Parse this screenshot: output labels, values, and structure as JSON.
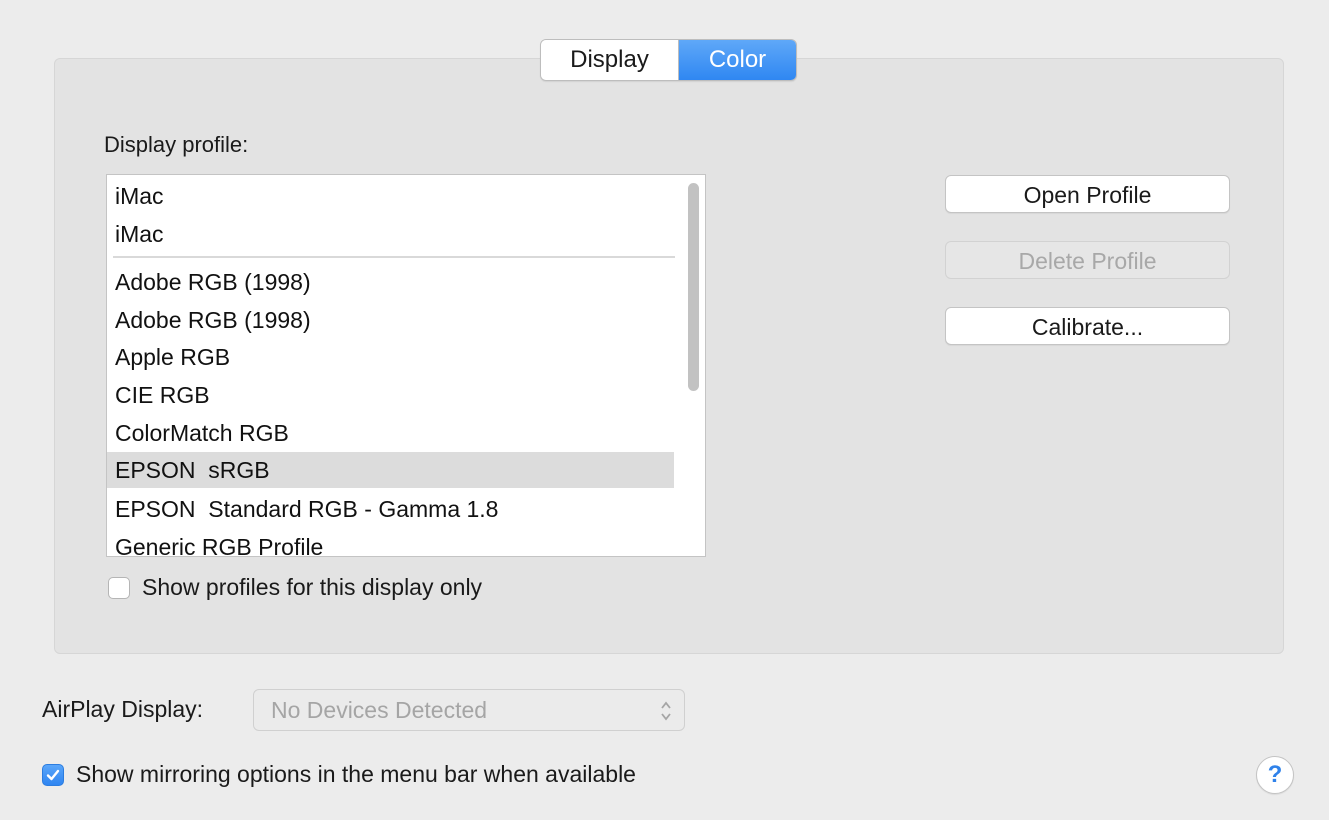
{
  "tabs": [
    {
      "label": "Display",
      "selected": false
    },
    {
      "label": "Color",
      "selected": true
    }
  ],
  "color_panel": {
    "profile_label": "Display profile:",
    "profiles": [
      "iMac",
      "iMac",
      "Adobe RGB (1998)",
      "Adobe RGB (1998)",
      "Apple RGB",
      "CIE RGB",
      "ColorMatch RGB",
      "EPSON  sRGB",
      "EPSON  Standard RGB - Gamma 1.8",
      "Generic RGB Profile"
    ],
    "selected_profile": "EPSON  sRGB",
    "show_display_only_label": "Show profiles for this display only",
    "show_display_only_checked": false,
    "buttons": {
      "open": "Open Profile",
      "delete": "Delete Profile",
      "calibrate": "Calibrate..."
    }
  },
  "airplay": {
    "label": "AirPlay Display:",
    "value": "No Devices Detected"
  },
  "mirroring": {
    "label": "Show mirroring options in the menu bar when available",
    "checked": true
  },
  "colors": {
    "accent": "#2f87f2",
    "selected_row": "#dcdcdc"
  }
}
